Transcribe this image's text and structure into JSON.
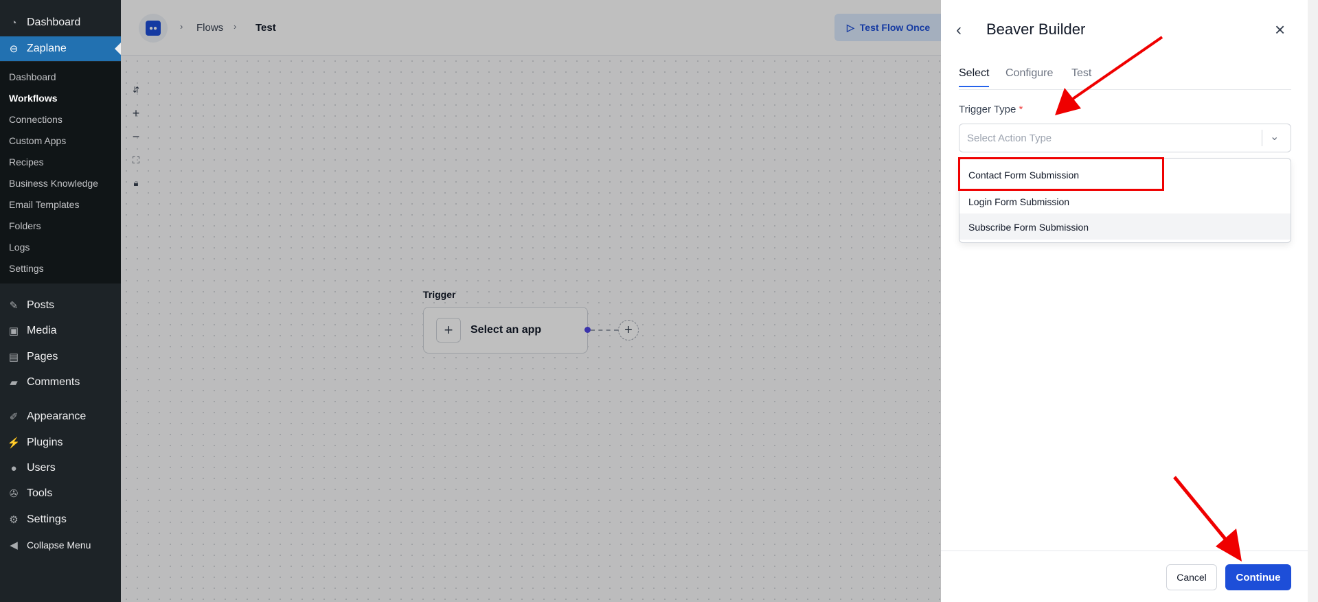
{
  "wp_menu": {
    "dashboard": "Dashboard",
    "zaplane": "Zaplane",
    "submenu": [
      "Dashboard",
      "Workflows",
      "Connections",
      "Custom Apps",
      "Recipes",
      "Business Knowledge",
      "Email Templates",
      "Folders",
      "Logs",
      "Settings"
    ],
    "posts": "Posts",
    "media": "Media",
    "pages": "Pages",
    "comments": "Comments",
    "appearance": "Appearance",
    "plugins": "Plugins",
    "users": "Users",
    "tools": "Tools",
    "settings": "Settings",
    "collapse": "Collapse Menu"
  },
  "header": {
    "breadcrumb": [
      "Flows",
      "Test"
    ],
    "test_flow_button": "Test Flow Once"
  },
  "canvas": {
    "trigger_label": "Trigger",
    "select_app": "Select an app"
  },
  "panel": {
    "title": "Beaver Builder",
    "tabs": [
      "Select",
      "Configure",
      "Test"
    ],
    "field_label": "Trigger Type",
    "required_mark": "*",
    "select_placeholder": "Select Action Type",
    "options": [
      "Contact Form Submission",
      "Login Form Submission",
      "Subscribe Form Submission"
    ],
    "cancel": "Cancel",
    "continue": "Continue"
  },
  "colors": {
    "wp_sidebar": "#1d2327",
    "wp_active": "#2271b1",
    "primary": "#1d4ed8",
    "annotation_red": "#ef0000"
  }
}
